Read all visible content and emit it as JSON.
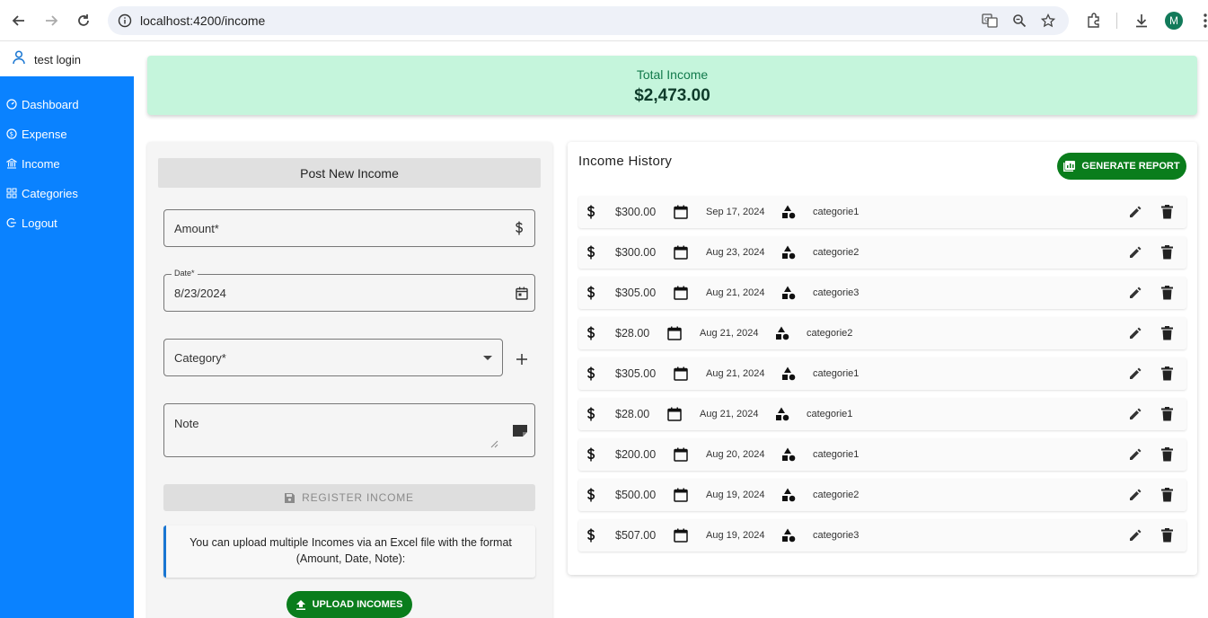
{
  "browser": {
    "url": "localhost:4200/income",
    "profile_initial": "M"
  },
  "user": {
    "name": "test login"
  },
  "sidebar": {
    "items": [
      {
        "label": "Dashboard",
        "icon": "gauge-icon"
      },
      {
        "label": "Expense",
        "icon": "dollar-circle-icon"
      },
      {
        "label": "Income",
        "icon": "bank-icon"
      },
      {
        "label": "Categories",
        "icon": "grid-icon"
      },
      {
        "label": "Logout",
        "icon": "logout-icon"
      }
    ]
  },
  "total": {
    "title": "Total Income",
    "value": "$2,473.00"
  },
  "form": {
    "title": "Post New Income",
    "amount_label": "Amount*",
    "date_label": "Date*",
    "date_value": "8/23/2024",
    "category_label": "Category*",
    "note_label": "Note",
    "register_label": "REGISTER INCOME",
    "info_text": "You can upload multiple Incomes via an Excel file with the format (Amount, Date, Note):",
    "upload_label": "UPLOAD INCOMES"
  },
  "history": {
    "title": "Income History",
    "generate_label": "GENERATE REPORT",
    "rows": [
      {
        "amount": "$300.00",
        "date": "Sep 17, 2024",
        "category": "categorie1"
      },
      {
        "amount": "$300.00",
        "date": "Aug 23, 2024",
        "category": "categorie2"
      },
      {
        "amount": "$305.00",
        "date": "Aug 21, 2024",
        "category": "categorie3"
      },
      {
        "amount": "$28.00",
        "date": "Aug 21, 2024",
        "category": "categorie2"
      },
      {
        "amount": "$305.00",
        "date": "Aug 21, 2024",
        "category": "categorie1"
      },
      {
        "amount": "$28.00",
        "date": "Aug 21, 2024",
        "category": "categorie1"
      },
      {
        "amount": "$200.00",
        "date": "Aug 20, 2024",
        "category": "categorie1"
      },
      {
        "amount": "$500.00",
        "date": "Aug 19, 2024",
        "category": "categorie2"
      },
      {
        "amount": "$507.00",
        "date": "Aug 19, 2024",
        "category": "categorie3"
      }
    ]
  },
  "colors": {
    "sidebar": "#0a82ff",
    "total_card": "#c5f5dc",
    "primary_button": "#0a7d1c",
    "info_accent": "#1976d2"
  }
}
